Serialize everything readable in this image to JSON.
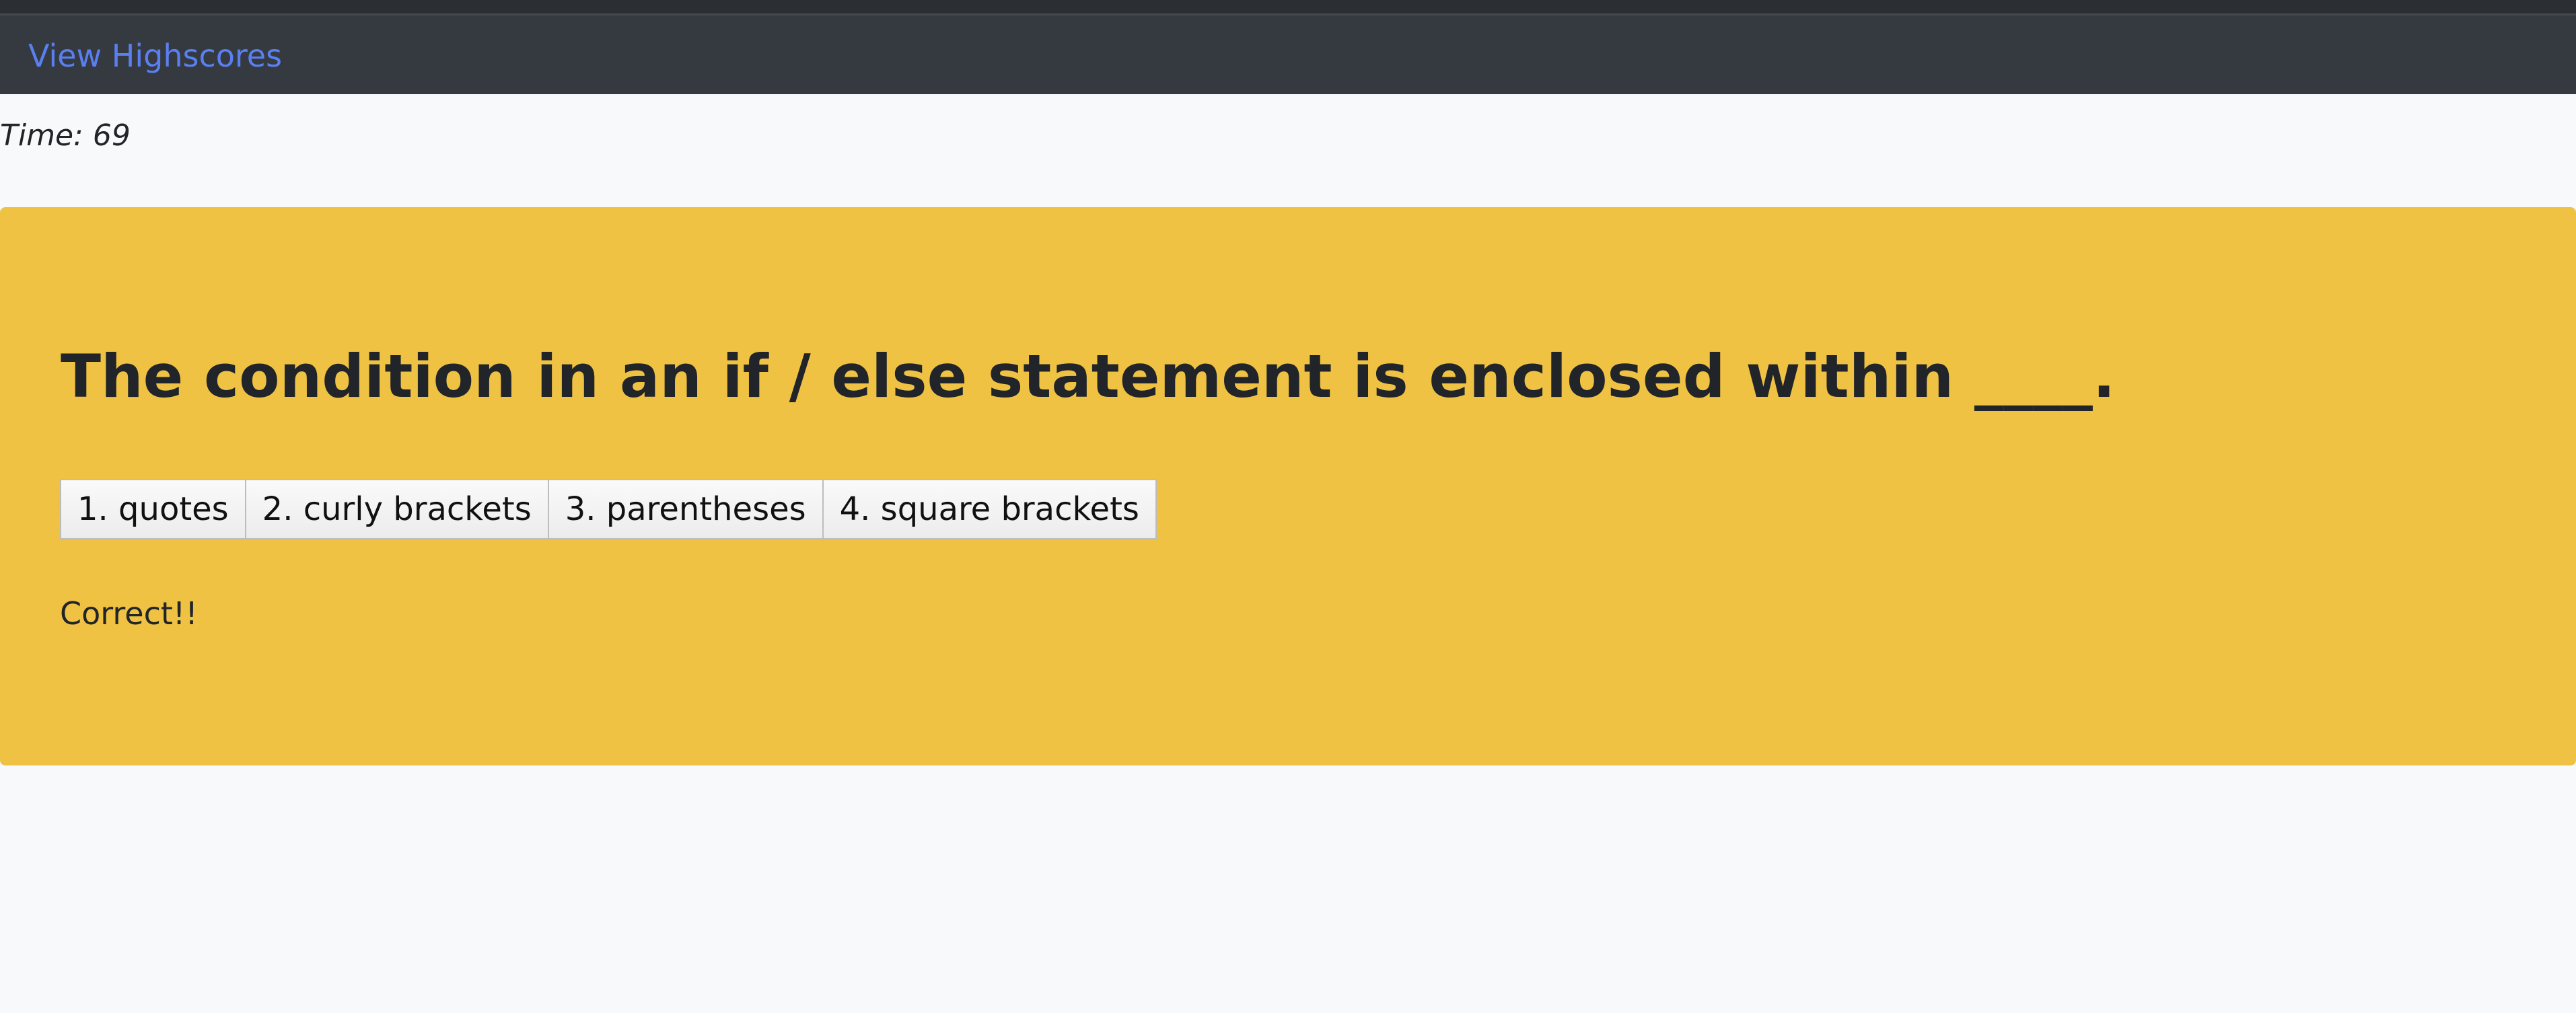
{
  "nav": {
    "highscores_link": "View Highscores"
  },
  "timer": {
    "text": "Time: 69",
    "seconds": 69
  },
  "quiz": {
    "question": "The condition in an if / else statement is enclosed within ____.",
    "answers": [
      {
        "label": "1. quotes"
      },
      {
        "label": "2. curly brackets"
      },
      {
        "label": "3. parentheses"
      },
      {
        "label": "4. square brackets"
      }
    ],
    "feedback": "Correct!!"
  },
  "colors": {
    "navbar_bg": "#343a40",
    "link": "#5a7ff0",
    "card_bg": "#efc243",
    "page_bg": "#f8f9fa"
  }
}
